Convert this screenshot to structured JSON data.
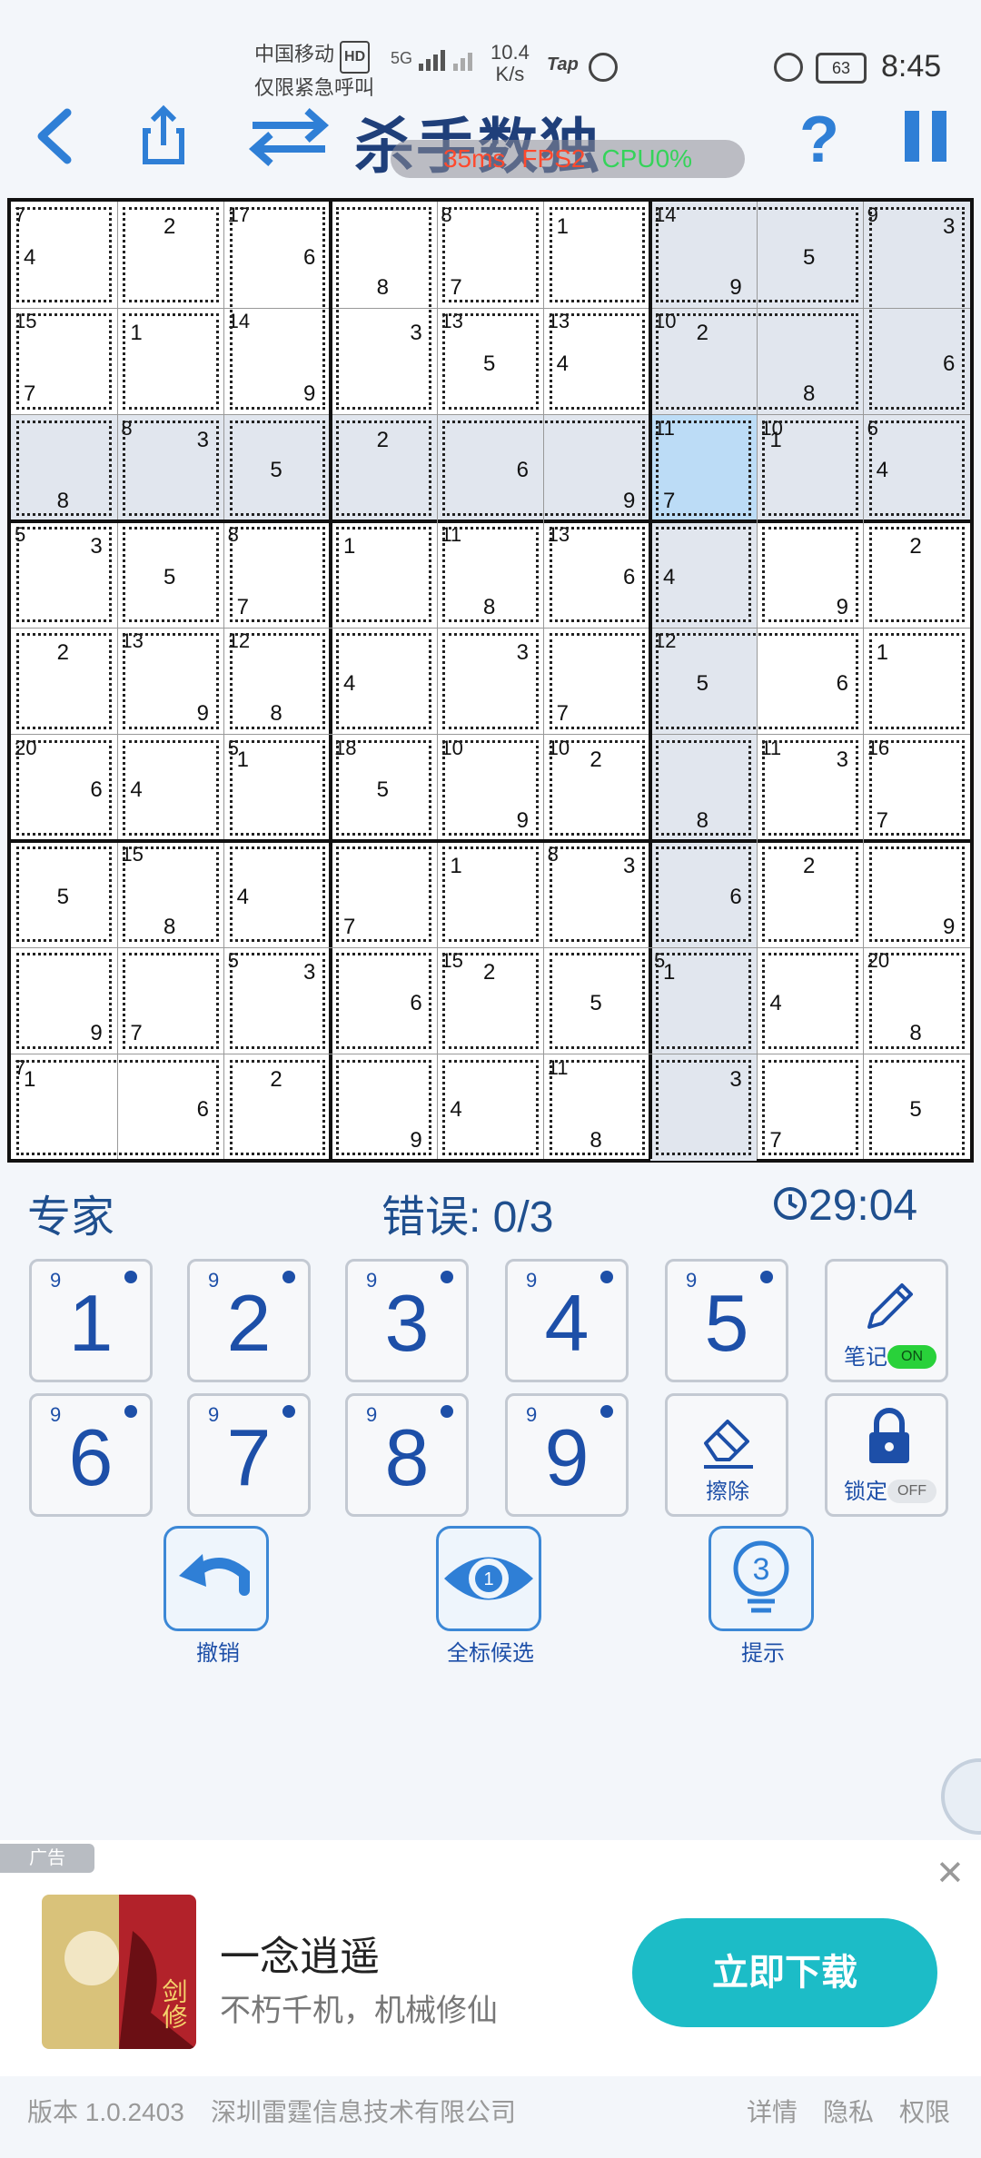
{
  "status_bar": {
    "carrier": "中国移动",
    "hd": "HD",
    "carrier_sub": "仅限紧急呼叫",
    "network": "5G",
    "speed_value": "10.4",
    "speed_unit": "K/s",
    "tap": "Tap",
    "battery": "63",
    "time": "8:45"
  },
  "header": {
    "title": "杀手数独",
    "perf": {
      "ms": "35ms",
      "fps": "FPS2",
      "cpu": "CPU0%"
    }
  },
  "board": {
    "shaded_cells": [
      [
        0,
        6
      ],
      [
        0,
        7
      ],
      [
        0,
        8
      ],
      [
        1,
        6
      ],
      [
        1,
        7
      ],
      [
        1,
        8
      ],
      [
        2,
        0
      ],
      [
        2,
        1
      ],
      [
        2,
        2
      ],
      [
        2,
        3
      ],
      [
        2,
        4
      ],
      [
        2,
        5
      ],
      [
        2,
        7
      ],
      [
        2,
        8
      ],
      [
        3,
        6
      ],
      [
        4,
        6
      ],
      [
        5,
        6
      ],
      [
        6,
        6
      ],
      [
        7,
        6
      ],
      [
        8,
        6
      ]
    ],
    "selected_cell": [
      2,
      6
    ],
    "cells": [
      [
        {
          "sum": "7",
          "note": "4"
        },
        {
          "note": "2"
        },
        {
          "sum": "17",
          "note": "6"
        },
        {
          "note": "8"
        },
        {
          "sum": "8",
          "note": "7"
        },
        {
          "note": "1"
        },
        {
          "sum": "14",
          "note": "9"
        },
        {
          "note": "5"
        },
        {
          "sum": "9",
          "note": "3"
        }
      ],
      [
        {
          "sum": "15",
          "note": "7"
        },
        {
          "note": "1"
        },
        {
          "sum": "14",
          "note": "9"
        },
        {
          "note": "3"
        },
        {
          "sum": "13",
          "note": "5"
        },
        {
          "sum": "13",
          "note": "4"
        },
        {
          "sum": "10",
          "note": "2"
        },
        {
          "note": "8"
        },
        {
          "note": "6"
        }
      ],
      [
        {
          "note": "8"
        },
        {
          "sum": "8",
          "note": "3"
        },
        {
          "note": "5"
        },
        {
          "note": "2"
        },
        {
          "note": "6"
        },
        {
          "note": "9"
        },
        {
          "sum": "11",
          "note": "7"
        },
        {
          "sum": "10",
          "note": "1"
        },
        {
          "sum": "6",
          "note": "4"
        }
      ],
      [
        {
          "sum": "5",
          "note": "3"
        },
        {
          "note": "5"
        },
        {
          "sum": "8",
          "note": "7"
        },
        {
          "note": "1"
        },
        {
          "sum": "11",
          "note": "8"
        },
        {
          "sum": "13",
          "note": "6"
        },
        {
          "note": "4"
        },
        {
          "note": "9"
        },
        {
          "note": "2"
        }
      ],
      [
        {
          "note": "2"
        },
        {
          "sum": "13",
          "note": "9"
        },
        {
          "sum": "12",
          "note": "8"
        },
        {
          "note": "4"
        },
        {
          "note": "3"
        },
        {
          "note": "7"
        },
        {
          "sum": "12",
          "note": "5"
        },
        {
          "note": "6"
        },
        {
          "note": "1"
        }
      ],
      [
        {
          "sum": "20",
          "note": "6"
        },
        {
          "note": "4"
        },
        {
          "sum": "5",
          "note": "1"
        },
        {
          "sum": "18",
          "note": "5"
        },
        {
          "sum": "10",
          "note": "9"
        },
        {
          "sum": "10",
          "note": "2"
        },
        {
          "note": "8"
        },
        {
          "sum": "11",
          "note": "3"
        },
        {
          "sum": "16",
          "note": "7"
        }
      ],
      [
        {
          "note": "5"
        },
        {
          "sum": "15",
          "note": "8"
        },
        {
          "note": "4"
        },
        {
          "note": "7"
        },
        {
          "note": "1"
        },
        {
          "sum": "8",
          "note": "3"
        },
        {
          "note": "6"
        },
        {
          "note": "2"
        },
        {
          "note": "9"
        }
      ],
      [
        {
          "note": "9"
        },
        {
          "note": "7"
        },
        {
          "sum": "5",
          "note": "3"
        },
        {
          "note": "6"
        },
        {
          "sum": "15",
          "note": "2"
        },
        {
          "note": "5"
        },
        {
          "sum": "5",
          "note": "1"
        },
        {
          "note": "4"
        },
        {
          "sum": "20",
          "note": "8"
        }
      ],
      [
        {
          "sum": "7",
          "note": "1"
        },
        {
          "note": "6"
        },
        {
          "note": "2"
        },
        {
          "note": "9"
        },
        {
          "note": "4"
        },
        {
          "sum": "11",
          "note": "8"
        },
        {
          "note": "3"
        },
        {
          "note": "7"
        },
        {
          "note": "5"
        }
      ]
    ],
    "cages": [
      [
        [
          0,
          0
        ],
        [
          0,
          0
        ]
      ],
      [
        [
          0,
          1
        ],
        [
          0,
          1
        ]
      ],
      [
        [
          0,
          2
        ],
        [
          1,
          2
        ]
      ],
      [
        [
          0,
          3
        ],
        [
          1,
          3
        ]
      ],
      [
        [
          0,
          4
        ],
        [
          0,
          4
        ]
      ],
      [
        [
          0,
          5
        ],
        [
          0,
          5
        ]
      ],
      [
        [
          0,
          6
        ],
        [
          0,
          7
        ]
      ],
      [
        [
          0,
          8
        ],
        [
          1,
          8
        ]
      ],
      [
        [
          1,
          0
        ],
        [
          1,
          0
        ]
      ],
      [
        [
          1,
          1
        ],
        [
          1,
          1
        ]
      ],
      [
        [
          1,
          4
        ],
        [
          1,
          4
        ]
      ],
      [
        [
          1,
          5
        ],
        [
          1,
          5
        ]
      ],
      [
        [
          1,
          6
        ],
        [
          1,
          7
        ]
      ],
      [
        [
          2,
          0
        ],
        [
          2,
          0
        ]
      ],
      [
        [
          2,
          1
        ],
        [
          2,
          1
        ]
      ],
      [
        [
          2,
          2
        ],
        [
          2,
          2
        ]
      ],
      [
        [
          2,
          3
        ],
        [
          2,
          3
        ]
      ],
      [
        [
          2,
          4
        ],
        [
          2,
          5
        ]
      ],
      [
        [
          2,
          6
        ],
        [
          2,
          6
        ]
      ],
      [
        [
          2,
          7
        ],
        [
          2,
          7
        ]
      ],
      [
        [
          2,
          8
        ],
        [
          2,
          8
        ]
      ],
      [
        [
          3,
          0
        ],
        [
          3,
          0
        ]
      ],
      [
        [
          3,
          1
        ],
        [
          3,
          1
        ]
      ],
      [
        [
          3,
          2
        ],
        [
          3,
          2
        ]
      ],
      [
        [
          3,
          3
        ],
        [
          3,
          3
        ]
      ],
      [
        [
          3,
          4
        ],
        [
          3,
          4
        ]
      ],
      [
        [
          3,
          5
        ],
        [
          3,
          5
        ]
      ],
      [
        [
          3,
          6
        ],
        [
          3,
          6
        ]
      ],
      [
        [
          3,
          7
        ],
        [
          3,
          7
        ]
      ],
      [
        [
          3,
          8
        ],
        [
          3,
          8
        ]
      ],
      [
        [
          4,
          0
        ],
        [
          4,
          0
        ]
      ],
      [
        [
          4,
          1
        ],
        [
          4,
          1
        ]
      ],
      [
        [
          4,
          2
        ],
        [
          4,
          2
        ]
      ],
      [
        [
          4,
          3
        ],
        [
          4,
          3
        ]
      ],
      [
        [
          4,
          4
        ],
        [
          4,
          4
        ]
      ],
      [
        [
          4,
          5
        ],
        [
          4,
          5
        ]
      ],
      [
        [
          4,
          6
        ],
        [
          4,
          7
        ]
      ],
      [
        [
          4,
          8
        ],
        [
          4,
          8
        ]
      ],
      [
        [
          5,
          0
        ],
        [
          5,
          0
        ]
      ],
      [
        [
          5,
          1
        ],
        [
          5,
          1
        ]
      ],
      [
        [
          5,
          2
        ],
        [
          5,
          2
        ]
      ],
      [
        [
          5,
          3
        ],
        [
          5,
          3
        ]
      ],
      [
        [
          5,
          4
        ],
        [
          5,
          4
        ]
      ],
      [
        [
          5,
          5
        ],
        [
          5,
          5
        ]
      ],
      [
        [
          5,
          6
        ],
        [
          5,
          6
        ]
      ],
      [
        [
          5,
          7
        ],
        [
          5,
          7
        ]
      ],
      [
        [
          5,
          8
        ],
        [
          5,
          8
        ]
      ],
      [
        [
          6,
          0
        ],
        [
          6,
          0
        ]
      ],
      [
        [
          6,
          1
        ],
        [
          6,
          1
        ]
      ],
      [
        [
          6,
          2
        ],
        [
          6,
          2
        ]
      ],
      [
        [
          6,
          3
        ],
        [
          6,
          3
        ]
      ],
      [
        [
          6,
          4
        ],
        [
          6,
          4
        ]
      ],
      [
        [
          6,
          5
        ],
        [
          6,
          5
        ]
      ],
      [
        [
          6,
          6
        ],
        [
          6,
          6
        ]
      ],
      [
        [
          6,
          7
        ],
        [
          6,
          7
        ]
      ],
      [
        [
          6,
          8
        ],
        [
          6,
          8
        ]
      ],
      [
        [
          7,
          0
        ],
        [
          7,
          0
        ]
      ],
      [
        [
          7,
          1
        ],
        [
          7,
          1
        ]
      ],
      [
        [
          7,
          2
        ],
        [
          7,
          2
        ]
      ],
      [
        [
          7,
          3
        ],
        [
          7,
          3
        ]
      ],
      [
        [
          7,
          4
        ],
        [
          7,
          4
        ]
      ],
      [
        [
          7,
          5
        ],
        [
          7,
          5
        ]
      ],
      [
        [
          7,
          6
        ],
        [
          7,
          6
        ]
      ],
      [
        [
          7,
          7
        ],
        [
          7,
          7
        ]
      ],
      [
        [
          7,
          8
        ],
        [
          7,
          8
        ]
      ],
      [
        [
          8,
          0
        ],
        [
          8,
          1
        ]
      ],
      [
        [
          8,
          2
        ],
        [
          8,
          2
        ]
      ],
      [
        [
          8,
          3
        ],
        [
          8,
          3
        ]
      ],
      [
        [
          8,
          4
        ],
        [
          8,
          4
        ]
      ],
      [
        [
          8,
          5
        ],
        [
          8,
          5
        ]
      ],
      [
        [
          8,
          6
        ],
        [
          8,
          6
        ]
      ],
      [
        [
          8,
          7
        ],
        [
          8,
          7
        ]
      ],
      [
        [
          8,
          8
        ],
        [
          8,
          8
        ]
      ]
    ]
  },
  "info": {
    "difficulty": "专家",
    "errors": "错误: 0/3",
    "timer": "29:04"
  },
  "keypad": {
    "digits": [
      {
        "digit": "1",
        "count": "9"
      },
      {
        "digit": "2",
        "count": "9"
      },
      {
        "digit": "3",
        "count": "9"
      },
      {
        "digit": "4",
        "count": "9"
      },
      {
        "digit": "5",
        "count": "9"
      },
      {
        "digit": "6",
        "count": "9"
      },
      {
        "digit": "7",
        "count": "9"
      },
      {
        "digit": "8",
        "count": "9"
      },
      {
        "digit": "9",
        "count": "9"
      }
    ],
    "notes_label": "笔记",
    "notes_state": "ON",
    "erase_label": "擦除",
    "lock_label": "锁定",
    "lock_state": "OFF"
  },
  "actions": {
    "undo": "撤销",
    "candidates": "全标候选",
    "candidates_count": "1",
    "hint": "提示",
    "hint_count": "3"
  },
  "ad": {
    "tag": "广告",
    "title": "一念逍遥",
    "subtitle": "不朽千机，机械修仙",
    "button": "立即下载",
    "image_text": "剑修"
  },
  "footer": {
    "version": "版本 1.0.2403",
    "company": "深圳雷霆信息技术有限公司",
    "details": "详情",
    "privacy": "隐私",
    "permissions": "权限"
  },
  "colors": {
    "accent": "#1d4fa8",
    "selected": "#bcdcf6",
    "shaded": "#e1e6ee",
    "ad_button": "#1cbcc7"
  }
}
